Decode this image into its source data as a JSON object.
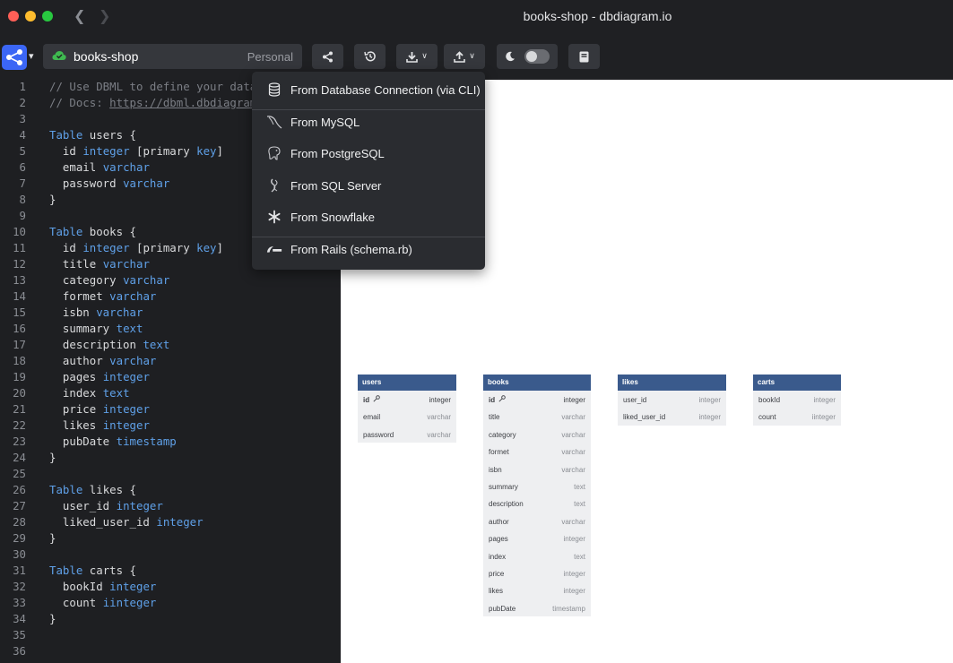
{
  "window": {
    "title": "books-shop - dbdiagram.io"
  },
  "toolbar": {
    "project_name": "books-shop",
    "project_scope": "Personal",
    "icons": [
      "share-icon",
      "history-icon",
      "download-icon",
      "upload-icon",
      "moon-icon",
      "book-icon"
    ]
  },
  "colors": {
    "accent": "#3b66f5",
    "table_header": "#3a5a8c",
    "keyword": "#5fa0e8"
  },
  "editor": {
    "lines": [
      {
        "n": "1",
        "t": [
          [
            "c",
            "// Use DBML to define your datab"
          ]
        ]
      },
      {
        "n": "2",
        "t": [
          [
            "c",
            "// Docs: "
          ],
          [
            "l",
            "https://dbml.dbdiagram"
          ]
        ]
      },
      {
        "n": "3",
        "t": []
      },
      {
        "n": "4",
        "t": [
          [
            "k",
            "Table"
          ],
          [
            "p",
            " users {"
          ]
        ]
      },
      {
        "n": "5",
        "t": [
          [
            "p",
            "  id "
          ],
          [
            "k",
            "integer"
          ],
          [
            "p",
            " [primary "
          ],
          [
            "k",
            "key"
          ],
          [
            "p",
            "]"
          ]
        ]
      },
      {
        "n": "6",
        "t": [
          [
            "p",
            "  email "
          ],
          [
            "k",
            "varchar"
          ]
        ]
      },
      {
        "n": "7",
        "t": [
          [
            "p",
            "  password "
          ],
          [
            "k",
            "varchar"
          ]
        ]
      },
      {
        "n": "8",
        "t": [
          [
            "p",
            "}"
          ]
        ]
      },
      {
        "n": "9",
        "t": []
      },
      {
        "n": "10",
        "t": [
          [
            "k",
            "Table"
          ],
          [
            "p",
            " books {"
          ]
        ]
      },
      {
        "n": "11",
        "t": [
          [
            "p",
            "  id "
          ],
          [
            "k",
            "integer"
          ],
          [
            "p",
            " [primary "
          ],
          [
            "k",
            "key"
          ],
          [
            "p",
            "]"
          ]
        ]
      },
      {
        "n": "12",
        "t": [
          [
            "p",
            "  title "
          ],
          [
            "k",
            "varchar"
          ]
        ]
      },
      {
        "n": "13",
        "t": [
          [
            "p",
            "  category "
          ],
          [
            "k",
            "varchar"
          ]
        ]
      },
      {
        "n": "14",
        "t": [
          [
            "p",
            "  formet "
          ],
          [
            "k",
            "varchar"
          ]
        ]
      },
      {
        "n": "15",
        "t": [
          [
            "p",
            "  isbn "
          ],
          [
            "k",
            "varchar"
          ]
        ]
      },
      {
        "n": "16",
        "t": [
          [
            "p",
            "  summary "
          ],
          [
            "k",
            "text"
          ]
        ]
      },
      {
        "n": "17",
        "t": [
          [
            "p",
            "  description "
          ],
          [
            "k",
            "text"
          ]
        ]
      },
      {
        "n": "18",
        "t": [
          [
            "p",
            "  author "
          ],
          [
            "k",
            "varchar"
          ]
        ]
      },
      {
        "n": "19",
        "t": [
          [
            "p",
            "  pages "
          ],
          [
            "k",
            "integer"
          ]
        ]
      },
      {
        "n": "20",
        "t": [
          [
            "p",
            "  index "
          ],
          [
            "k",
            "text"
          ]
        ]
      },
      {
        "n": "21",
        "t": [
          [
            "p",
            "  price "
          ],
          [
            "k",
            "integer"
          ]
        ]
      },
      {
        "n": "22",
        "t": [
          [
            "p",
            "  likes "
          ],
          [
            "k",
            "integer"
          ]
        ]
      },
      {
        "n": "23",
        "t": [
          [
            "p",
            "  pubDate "
          ],
          [
            "k",
            "timestamp"
          ]
        ]
      },
      {
        "n": "24",
        "t": [
          [
            "p",
            "}"
          ]
        ]
      },
      {
        "n": "25",
        "t": []
      },
      {
        "n": "26",
        "t": [
          [
            "k",
            "Table"
          ],
          [
            "p",
            " likes {"
          ]
        ]
      },
      {
        "n": "27",
        "t": [
          [
            "p",
            "  user_id "
          ],
          [
            "k",
            "integer"
          ]
        ]
      },
      {
        "n": "28",
        "t": [
          [
            "p",
            "  liked_user_id "
          ],
          [
            "k",
            "integer"
          ]
        ]
      },
      {
        "n": "29",
        "t": [
          [
            "p",
            "}"
          ]
        ]
      },
      {
        "n": "30",
        "t": []
      },
      {
        "n": "31",
        "t": [
          [
            "k",
            "Table"
          ],
          [
            "p",
            " carts {"
          ]
        ]
      },
      {
        "n": "32",
        "t": [
          [
            "p",
            "  bookId "
          ],
          [
            "k",
            "integer"
          ]
        ]
      },
      {
        "n": "33",
        "t": [
          [
            "p",
            "  count "
          ],
          [
            "k",
            "iinteger"
          ]
        ]
      },
      {
        "n": "34",
        "t": [
          [
            "p",
            "}"
          ]
        ]
      },
      {
        "n": "35",
        "t": []
      },
      {
        "n": "36",
        "t": []
      }
    ]
  },
  "import_menu": {
    "items": [
      {
        "label": "From Database Connection (via CLI)",
        "icon": "database-icon"
      },
      {
        "label": "From MySQL",
        "icon": "mysql-icon"
      },
      {
        "label": "From PostgreSQL",
        "icon": "postgresql-icon"
      },
      {
        "label": "From SQL Server",
        "icon": "sqlserver-icon"
      },
      {
        "label": "From Snowflake",
        "icon": "snowflake-icon"
      },
      {
        "label": "From Rails (schema.rb)",
        "icon": "rails-icon"
      }
    ]
  },
  "diagram": {
    "tables": [
      {
        "name": "users",
        "fields": [
          {
            "name": "id",
            "type": "integer",
            "pk": true
          },
          {
            "name": "email",
            "type": "varchar"
          },
          {
            "name": "password",
            "type": "varchar"
          }
        ]
      },
      {
        "name": "books",
        "fields": [
          {
            "name": "id",
            "type": "integer",
            "pk": true
          },
          {
            "name": "title",
            "type": "varchar"
          },
          {
            "name": "category",
            "type": "varchar"
          },
          {
            "name": "formet",
            "type": "varchar"
          },
          {
            "name": "isbn",
            "type": "varchar"
          },
          {
            "name": "summary",
            "type": "text"
          },
          {
            "name": "description",
            "type": "text"
          },
          {
            "name": "author",
            "type": "varchar"
          },
          {
            "name": "pages",
            "type": "integer"
          },
          {
            "name": "index",
            "type": "text"
          },
          {
            "name": "price",
            "type": "integer"
          },
          {
            "name": "likes",
            "type": "integer"
          },
          {
            "name": "pubDate",
            "type": "timestamp"
          }
        ]
      },
      {
        "name": "likes",
        "fields": [
          {
            "name": "user_id",
            "type": "integer"
          },
          {
            "name": "liked_user_id",
            "type": "integer"
          }
        ]
      },
      {
        "name": "carts",
        "fields": [
          {
            "name": "bookId",
            "type": "integer"
          },
          {
            "name": "count",
            "type": "iinteger"
          }
        ]
      }
    ]
  }
}
